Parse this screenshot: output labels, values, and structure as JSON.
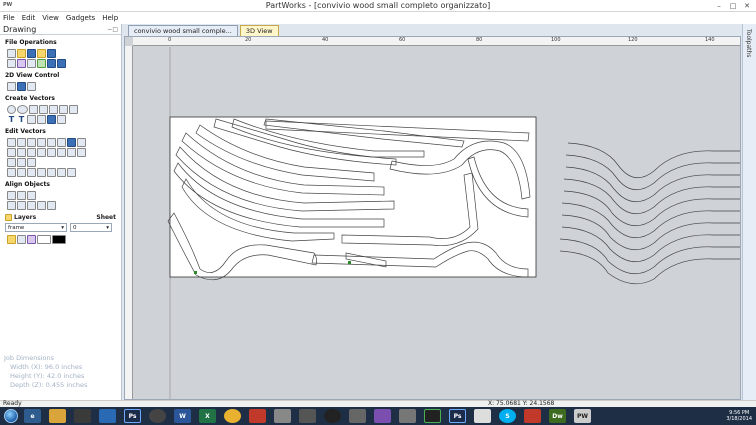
{
  "window": {
    "logo": "PW",
    "title": "PartWorks - [convivio wood small completo organizzato]"
  },
  "menu": [
    "File",
    "Edit",
    "View",
    "Gadgets",
    "Help"
  ],
  "left_panel": {
    "header": "Drawing",
    "sections": {
      "file_operations": "File Operations",
      "view_control": "2D View Control",
      "create_vectors": "Create Vectors",
      "edit_vectors": "Edit Vectors",
      "align_objects": "Align Objects"
    },
    "layers_label": "Layers",
    "sheet_label": "Sheet",
    "layer_value": "frame",
    "sheet_value": "0",
    "job_dimensions": {
      "title": "Job Dimensions",
      "width": "Width (X): 96.0 inches",
      "height": "Height (Y): 42.0 inches",
      "depth": "Depth (Z): 0.455 inches"
    }
  },
  "tabs": [
    {
      "label": "convivio wood small comple...",
      "active": false
    },
    {
      "label": "3D View",
      "active": true
    }
  ],
  "ruler": {
    "labels": [
      "0",
      "20",
      "40",
      "60",
      "80",
      "100",
      "120",
      "140"
    ]
  },
  "right_strip": {
    "label": "Toolpaths"
  },
  "status": {
    "ready": "Ready",
    "coords": "X: 75.0681 Y: 24.1568"
  },
  "clock": {
    "time": "9:56 PM",
    "date": "3/18/2014"
  },
  "colors": {
    "taskbar": "#1e2f45",
    "active_tab": "#fff6c9",
    "canvas_bg": "#cfd3d8",
    "sheet": "#ffffff"
  }
}
